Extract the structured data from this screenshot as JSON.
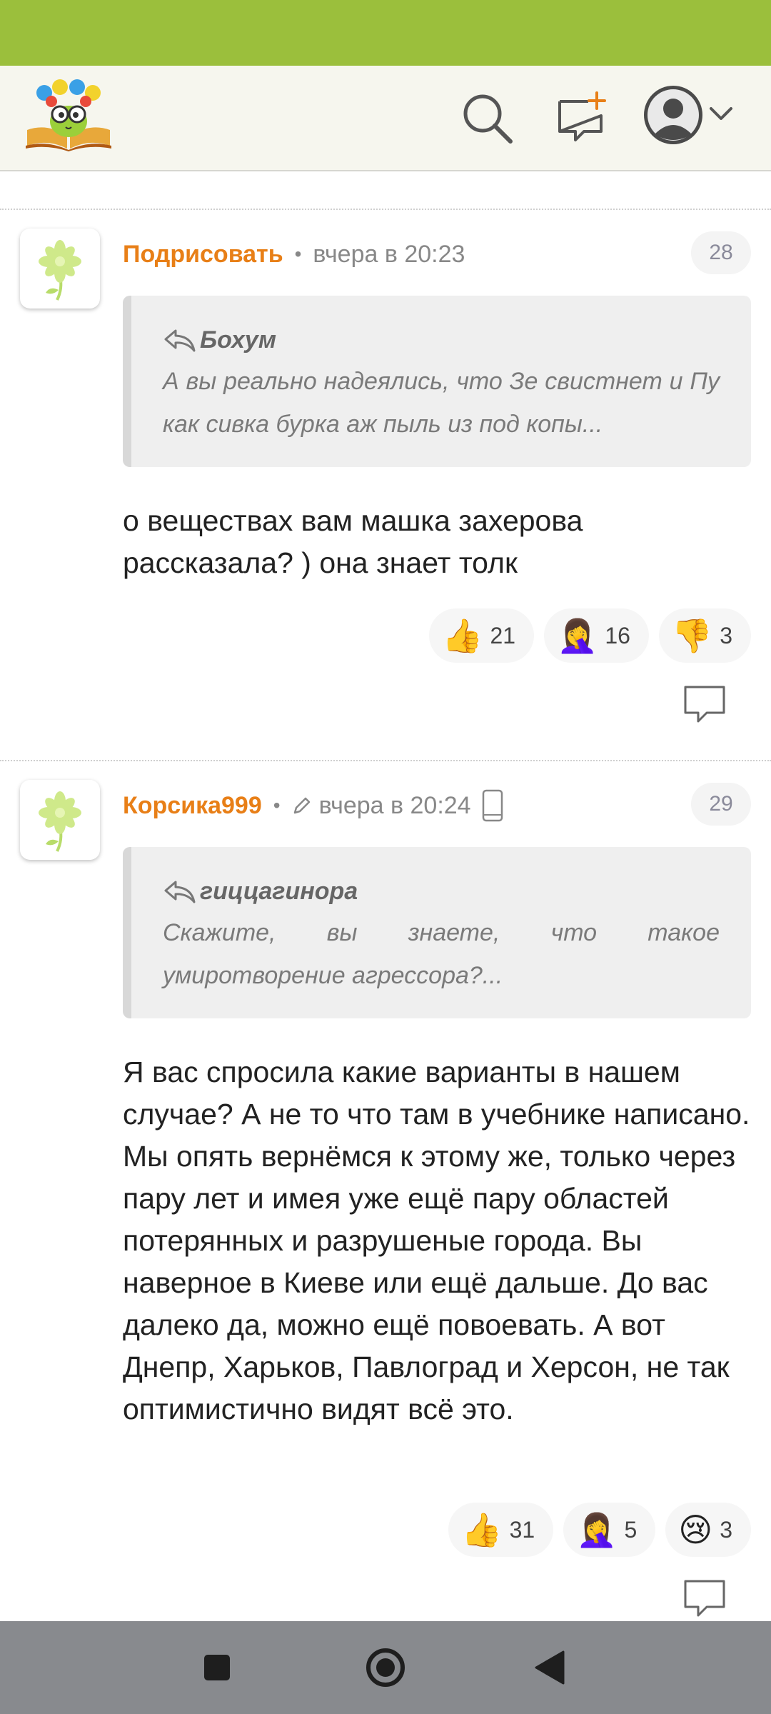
{
  "comments": [
    {
      "author": "Подрисовать",
      "time": "вчера в 20:23",
      "number": "28",
      "edited": false,
      "mobile": false,
      "quote": {
        "author": "Бохум",
        "text": "А вы реально надеялись, что Зе свистнет и Пу как сивка бурка аж пыль из под копы..."
      },
      "text": "о веществах вам машка захерова рассказала? ) она знает толк",
      "reactions": [
        {
          "icon": "thumbs-up",
          "emoji": "👍",
          "count": "21"
        },
        {
          "icon": "facepalm",
          "emoji": "🤦‍♀️",
          "count": "16"
        },
        {
          "icon": "thumbs-down",
          "emoji": "👎",
          "count": "3"
        }
      ]
    },
    {
      "author": "Корсика999",
      "time": "вчера в 20:24",
      "number": "29",
      "edited": true,
      "mobile": true,
      "quote": {
        "author": "гиццагинора",
        "text": "Скажите, вы знаете, что такое умиротворение агрессора?..."
      },
      "text": "Я вас спросила какие варианты в нашем случае? А не то что там в учебнике написано. Мы опять вернёмся к этому же, только через пару лет и имея уже ещё пару областей потерянных и разрушеные города. Вы наверное в Киеве или ещё дальше. До вас далеко да, можно ещё повоевать. А вот Днепр, Харьков, Павлоград и Херсон, не так оптимистично видят всё это.",
      "reactions": [
        {
          "icon": "thumbs-up",
          "emoji": "👍",
          "count": "31"
        },
        {
          "icon": "facepalm",
          "emoji": "🤦‍♀️",
          "count": "5"
        },
        {
          "icon": "crying-face",
          "emoji": "😢",
          "count": "3"
        }
      ]
    }
  ],
  "colors": {
    "status_bar": "#9bbf3c",
    "header_bg": "#f6f6ee",
    "author": "#e87f17",
    "nav_bar": "#888a8e"
  }
}
